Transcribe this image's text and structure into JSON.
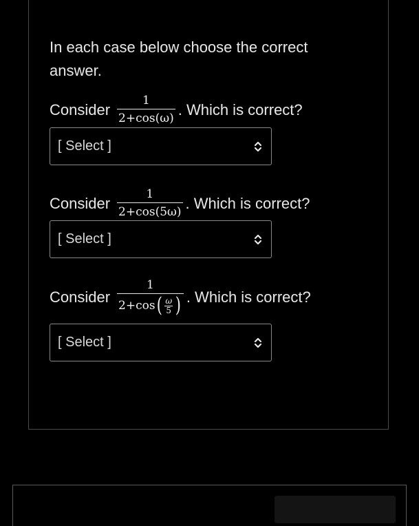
{
  "intro": "In each case below choose the correct answer.",
  "questions": [
    {
      "prefix": "Consider",
      "numerator": "1",
      "denominator": "2+cos(ω)",
      "suffix": ". Which is correct?",
      "select_value": "[ Select ]"
    },
    {
      "prefix": "Consider",
      "numerator": "1",
      "denominator": "2+cos(5ω)",
      "suffix": ". Which is correct?",
      "select_value": "[ Select ]"
    },
    {
      "prefix": "Consider",
      "numerator": "1",
      "denominator_prefix": "2+cos",
      "inner_numerator": "ω",
      "inner_denominator": "5",
      "suffix": ". Which is correct?",
      "select_value": "[ Select ]"
    }
  ],
  "icons": {
    "select_arrow": "chevron-up-down-icon"
  },
  "colors": {
    "background": "#000000",
    "text": "#e8e8e8",
    "border": "#8a8a8a"
  }
}
